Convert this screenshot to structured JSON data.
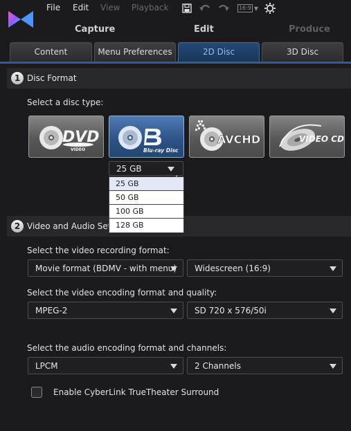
{
  "menu": {
    "file": "File",
    "edit": "Edit",
    "view": "View",
    "playback": "Playback",
    "aspect_ratio": "16:9"
  },
  "modes": {
    "capture": "Capture",
    "edit": "Edit",
    "produce": "Produce"
  },
  "tabs": [
    {
      "label": "Content",
      "active": false
    },
    {
      "label": "Menu Preferences",
      "active": false
    },
    {
      "label": "2D Disc",
      "active": true
    },
    {
      "label": "3D Disc",
      "active": false
    }
  ],
  "disc_format": {
    "step": "1",
    "title": "Disc Format",
    "prompt": "Select a disc type:",
    "disc_types": [
      {
        "name": "DVD",
        "icon": "dvd-video-logo",
        "selected": false
      },
      {
        "name": "Blu-ray Disc",
        "icon": "bluray-disc-logo",
        "selected": true
      },
      {
        "name": "AVCHD",
        "icon": "avchd-logo",
        "selected": false
      },
      {
        "name": "VIDEO CD",
        "icon": "video-cd-logo",
        "selected": false
      }
    ],
    "logo_text": {
      "dvd": "DVD",
      "dvd_sub": "VIDEO",
      "bluray": "Blu-ray Disc",
      "avchd": "AVCHD",
      "vcd": "VIDEO CD"
    },
    "disc_size": {
      "selected": "25 GB",
      "options": [
        "25 GB",
        "50 GB",
        "100 GB",
        "128 GB"
      ],
      "hovered": "25 GB"
    }
  },
  "video_audio": {
    "step": "2",
    "title": "Video and Audio Settings",
    "recording_label": "Select the video recording format:",
    "recording_format": "Movie format (BDMV - with menu)",
    "aspect": "Widescreen (16:9)",
    "encoding_label": "Select the video encoding format and quality:",
    "video_codec": "MPEG-2",
    "video_quality": "SD 720 x 576/50i",
    "audio_label": "Select the audio encoding format and channels:",
    "audio_codec": "LPCM",
    "audio_channels": "2 Channels",
    "surround_label": "Enable CyberLink TrueTheater Surround",
    "surround_checked": false
  },
  "colors": {
    "accent": "#2f5c92",
    "selected_disc": "#2c5285",
    "background": "#1b1b1d"
  }
}
